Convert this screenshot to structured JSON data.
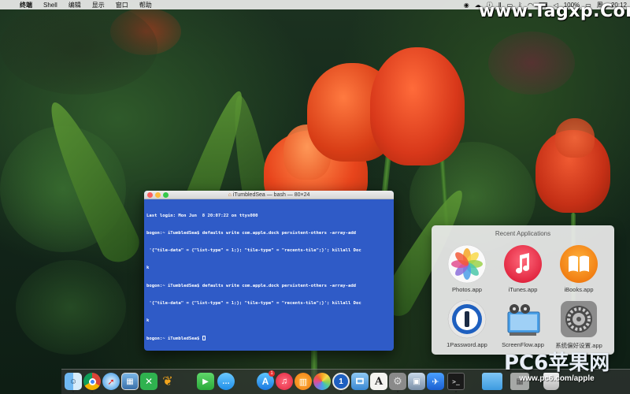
{
  "menubar": {
    "app_name": "终端",
    "items": [
      "Shell",
      "编辑",
      "显示",
      "窗口",
      "帮助"
    ],
    "battery": "100%",
    "clock": "周一 20:12"
  },
  "watermarks": {
    "top": "www.Tagxp.Com",
    "bottom_big": "PC6苹果网",
    "bottom_small": "www.pc6.com/apple"
  },
  "terminal": {
    "title": "iTumbledSea — bash — 80×24",
    "lines": [
      "Last login: Mon Jun  8 20:07:22 on ttys000",
      "bogon:~ iTumbledSea$ defaults write com.apple.dock persistent-others -array-add",
      " '{\"tile-data\" = {\"list-type\" = 1;}; \"tile-type\" = \"recents-tile\";}'; killall Doc",
      "k",
      "bogon:~ iTumbledSea$ defaults write com.apple.dock persistent-others -array-add",
      " '{\"tile-data\" = {\"list-type\" = 1;}; \"tile-type\" = \"recents-tile\";}'; killall Doc",
      "k",
      "bogon:~ iTumbledSea$ "
    ]
  },
  "recent_apps": {
    "header": "Recent Applications",
    "apps": [
      {
        "label": "Photos.app",
        "icon": "photos-icon"
      },
      {
        "label": "iTunes.app",
        "icon": "itunes-icon"
      },
      {
        "label": "iBooks.app",
        "icon": "ibooks-icon"
      },
      {
        "label": "1Password.app",
        "icon": "1password-icon"
      },
      {
        "label": "ScreenFlow.app",
        "icon": "screenflow-icon"
      },
      {
        "label": "系统偏好设置.app",
        "icon": "system-preferences-icon"
      }
    ]
  },
  "dock": {
    "appstore_badge": "1",
    "icons": [
      "finder-icon",
      "chrome-icon",
      "safari-icon",
      "preview-icon",
      "xmind-icon",
      "tes-butterfly-icon",
      "facetime-icon",
      "messages-icon",
      "app-store-icon",
      "itunes-icon",
      "ibooks-icon",
      "photos-icon",
      "1password-icon",
      "screenflow-icon",
      "font-book-icon",
      "system-preferences-icon",
      "image-capture-icon",
      "xcode-icon",
      "terminal-icon",
      "folder-icon",
      "recents-stack-icon",
      "trash-icon"
    ]
  }
}
